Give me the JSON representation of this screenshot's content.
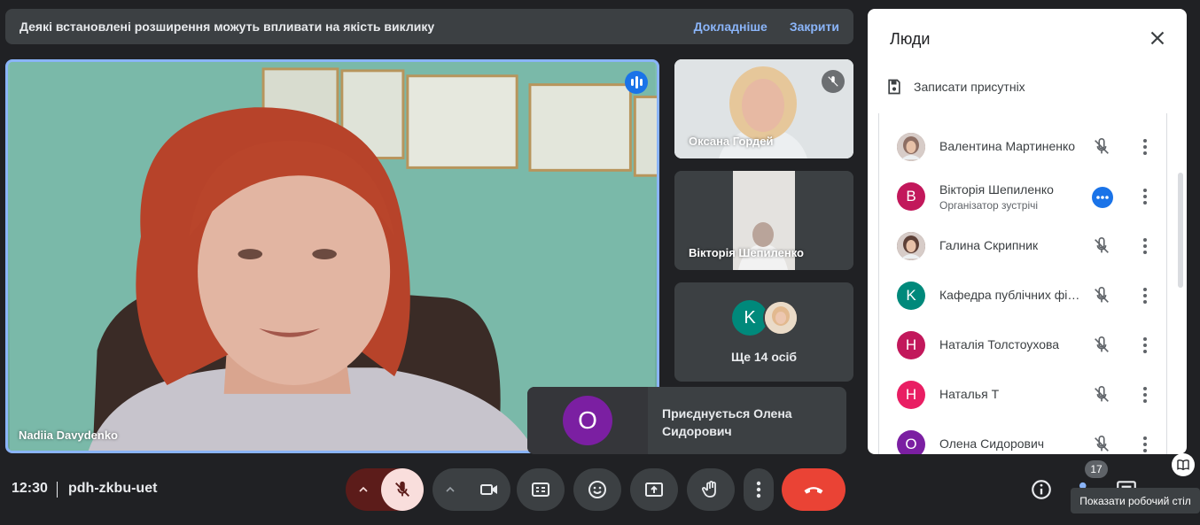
{
  "banner": {
    "text": "Деякі встановлені розширення можуть впливати на якість виклику",
    "learn_more": "Докладніше",
    "close": "Закрити"
  },
  "main_tile": {
    "name": "Nadiia Davydenko"
  },
  "side_tiles": [
    {
      "name": "Оксана Гордей"
    },
    {
      "name": "Вікторія Шепиленко"
    },
    {
      "avatar_letter": "K",
      "more_label": "Ще 14 осіб"
    }
  ],
  "join_toast": {
    "avatar_letter": "O",
    "text": "Приєднується Олена Сидорович"
  },
  "people_panel": {
    "title": "Люди",
    "record_label": "Записати присутніх",
    "people": [
      {
        "name": "Валентина Мартиненко",
        "avatar": "photo",
        "color": "#8d6e63",
        "letter": ""
      },
      {
        "name": "Вікторія Шепиленко",
        "role": "Організатор зустрічі",
        "avatar": "letter",
        "letter": "B",
        "color": "#c2185b",
        "host": true
      },
      {
        "name": "Галина Скрипник",
        "avatar": "photo",
        "color": "#5d4037",
        "letter": ""
      },
      {
        "name": "Кафедра публічних фін...",
        "avatar": "letter",
        "letter": "K",
        "color": "#00897b"
      },
      {
        "name": "Наталія Толстоухова",
        "avatar": "letter",
        "letter": "H",
        "color": "#c2185b"
      },
      {
        "name": "Наталья Т",
        "avatar": "letter",
        "letter": "H",
        "color": "#e91e63"
      },
      {
        "name": "Олена Сидорович",
        "avatar": "letter",
        "letter": "O",
        "color": "#7b1fa2"
      }
    ]
  },
  "bottom_bar": {
    "time": "12:30",
    "meeting_code": "pdh-zkbu-uet",
    "participants_count": "17",
    "tooltip": "Показати робочий стіл"
  },
  "colors": {
    "accent": "#8ab4f8",
    "end_call": "#ea4335",
    "mic_off_bg": "#f9dedc",
    "mic_group_bg": "#5c1c1a"
  }
}
